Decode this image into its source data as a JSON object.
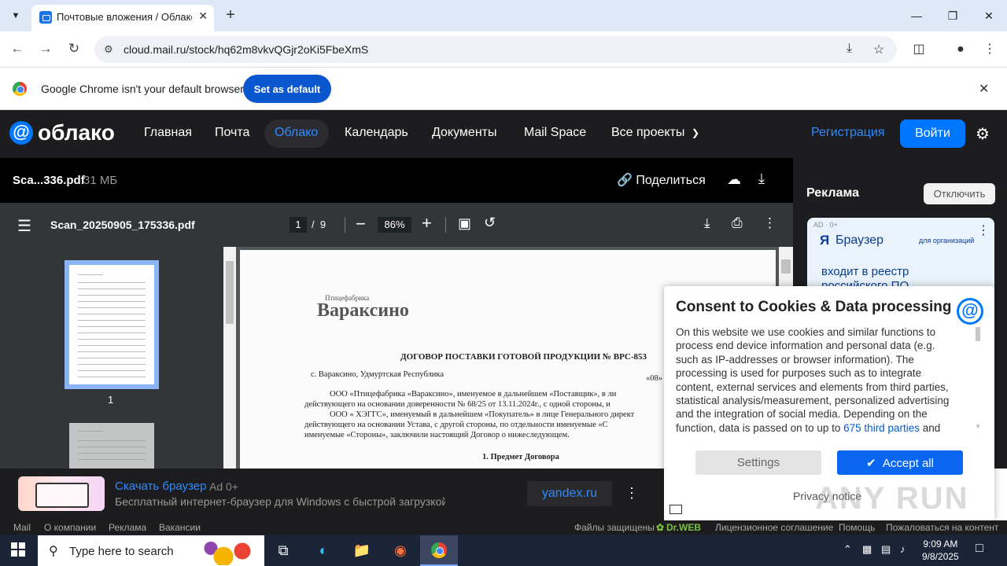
{
  "browser": {
    "tab_title": "Почтовые вложения / Облако",
    "url": "cloud.mail.ru/stock/hq62m8vkvQGjr2oKi5FbeXmS",
    "infobar_text": "Google Chrome isn't your default browser",
    "set_default_label": "Set as default"
  },
  "site": {
    "logo_text": "облако",
    "nav": [
      "Главная",
      "Почта",
      "Облако",
      "Календарь",
      "Документы",
      "Mail Space",
      "Все проекты"
    ],
    "register_label": "Регистрация",
    "login_label": "Войти"
  },
  "file": {
    "short_name": "Sca...336.pdf",
    "size": "31 МБ",
    "share_label": "Поделиться"
  },
  "pdf": {
    "name": "Scan_20250905_175336.pdf",
    "page_current": "1",
    "page_total": "9",
    "page_sep": "/",
    "zoom": "86%",
    "thumb_label": "1"
  },
  "document": {
    "brand_small": "Птицефабрика",
    "brand": "Вараксино",
    "heading": "ДОГОВОР ПОСТАВКИ ГОТОВОЙ ПРОДУКЦИИ № ВРС-853",
    "place": "с. Вараксино, Удмуртская Республика",
    "date_frag": "«08»",
    "lines": [
      "ООО «Птицефабрика «Вараксино», именуемое в дальнейшем «Поставщик», в ли",
      "действующего на основании доверенности № 68/25 от 13.11.2024г., с одной стороны, и",
      "ООО « ХЭГГС», именуемый в дальнейшем «Покупатель» в лице Генерального директ",
      "действующего на основании Устава, с другой стороны, по отдельности именуемые «С",
      "именуемые «Стороны», заключили настоящий Договор о нижеследующем."
    ],
    "section": "1. Предмет Договора"
  },
  "ads_panel": {
    "title": "Реклама",
    "disable_label": "Отключить",
    "card_badge": "AD · 0+",
    "card_brand": "Браузер",
    "card_org": "для организаций",
    "card_text_1": "входит в реестр",
    "card_text_2": "российского ПО"
  },
  "consent": {
    "title": "Consent to Cookies & Data processing",
    "body": "On this website we use cookies and similar functions to process end device information and personal data (e.g. such as IP-addresses or browser information). The processing is used for purposes such as to integrate content, external services and elements from third parties, statistical analysis/measurement, personalized advertising and the integration of social media. Depending on the function, data is passed on to up to ",
    "link": "675 third parties",
    "tail": " and",
    "settings_label": "Settings",
    "accept_label": "Accept all",
    "privacy_label": "Privacy notice"
  },
  "bottom_ad": {
    "link": "Скачать браузер",
    "badge": "Ad 0+",
    "desc": "Бесплатный интернет-браузер для Windows с быстрой загрузкой с...",
    "button": "yandex.ru"
  },
  "footer": {
    "left": [
      "Mail",
      "О компании",
      "Реклама",
      "Вакансии"
    ],
    "protected": "Файлы защищены",
    "drweb": "Dr.WEB",
    "right": [
      "Лицензионное соглашение",
      "Помощь",
      "Пожаловаться на контент"
    ]
  },
  "taskbar": {
    "search_placeholder": "Type here to search",
    "time": "9:09 AM",
    "date": "9/8/2025"
  },
  "watermark": "ANY RUN",
  "colors": {
    "accent": "#0077ff",
    "chrome_blue": "#0b57d0",
    "dark_bg": "#1d1d1f"
  }
}
